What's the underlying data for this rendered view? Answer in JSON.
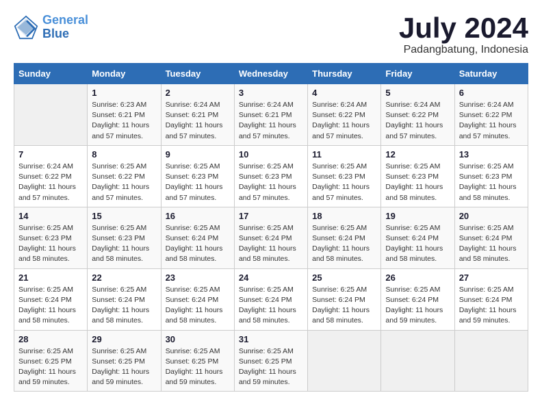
{
  "logo": {
    "line1": "General",
    "line2": "Blue"
  },
  "title": "July 2024",
  "subtitle": "Padangbatung, Indonesia",
  "days_of_week": [
    "Sunday",
    "Monday",
    "Tuesday",
    "Wednesday",
    "Thursday",
    "Friday",
    "Saturday"
  ],
  "weeks": [
    [
      {
        "day": "",
        "info": ""
      },
      {
        "day": "1",
        "info": "Sunrise: 6:23 AM\nSunset: 6:21 PM\nDaylight: 11 hours\nand 57 minutes."
      },
      {
        "day": "2",
        "info": "Sunrise: 6:24 AM\nSunset: 6:21 PM\nDaylight: 11 hours\nand 57 minutes."
      },
      {
        "day": "3",
        "info": "Sunrise: 6:24 AM\nSunset: 6:21 PM\nDaylight: 11 hours\nand 57 minutes."
      },
      {
        "day": "4",
        "info": "Sunrise: 6:24 AM\nSunset: 6:22 PM\nDaylight: 11 hours\nand 57 minutes."
      },
      {
        "day": "5",
        "info": "Sunrise: 6:24 AM\nSunset: 6:22 PM\nDaylight: 11 hours\nand 57 minutes."
      },
      {
        "day": "6",
        "info": "Sunrise: 6:24 AM\nSunset: 6:22 PM\nDaylight: 11 hours\nand 57 minutes."
      }
    ],
    [
      {
        "day": "7",
        "info": "Sunrise: 6:24 AM\nSunset: 6:22 PM\nDaylight: 11 hours\nand 57 minutes."
      },
      {
        "day": "8",
        "info": "Sunrise: 6:25 AM\nSunset: 6:22 PM\nDaylight: 11 hours\nand 57 minutes."
      },
      {
        "day": "9",
        "info": "Sunrise: 6:25 AM\nSunset: 6:23 PM\nDaylight: 11 hours\nand 57 minutes."
      },
      {
        "day": "10",
        "info": "Sunrise: 6:25 AM\nSunset: 6:23 PM\nDaylight: 11 hours\nand 57 minutes."
      },
      {
        "day": "11",
        "info": "Sunrise: 6:25 AM\nSunset: 6:23 PM\nDaylight: 11 hours\nand 57 minutes."
      },
      {
        "day": "12",
        "info": "Sunrise: 6:25 AM\nSunset: 6:23 PM\nDaylight: 11 hours\nand 58 minutes."
      },
      {
        "day": "13",
        "info": "Sunrise: 6:25 AM\nSunset: 6:23 PM\nDaylight: 11 hours\nand 58 minutes."
      }
    ],
    [
      {
        "day": "14",
        "info": "Sunrise: 6:25 AM\nSunset: 6:23 PM\nDaylight: 11 hours\nand 58 minutes."
      },
      {
        "day": "15",
        "info": "Sunrise: 6:25 AM\nSunset: 6:23 PM\nDaylight: 11 hours\nand 58 minutes."
      },
      {
        "day": "16",
        "info": "Sunrise: 6:25 AM\nSunset: 6:24 PM\nDaylight: 11 hours\nand 58 minutes."
      },
      {
        "day": "17",
        "info": "Sunrise: 6:25 AM\nSunset: 6:24 PM\nDaylight: 11 hours\nand 58 minutes."
      },
      {
        "day": "18",
        "info": "Sunrise: 6:25 AM\nSunset: 6:24 PM\nDaylight: 11 hours\nand 58 minutes."
      },
      {
        "day": "19",
        "info": "Sunrise: 6:25 AM\nSunset: 6:24 PM\nDaylight: 11 hours\nand 58 minutes."
      },
      {
        "day": "20",
        "info": "Sunrise: 6:25 AM\nSunset: 6:24 PM\nDaylight: 11 hours\nand 58 minutes."
      }
    ],
    [
      {
        "day": "21",
        "info": "Sunrise: 6:25 AM\nSunset: 6:24 PM\nDaylight: 11 hours\nand 58 minutes."
      },
      {
        "day": "22",
        "info": "Sunrise: 6:25 AM\nSunset: 6:24 PM\nDaylight: 11 hours\nand 58 minutes."
      },
      {
        "day": "23",
        "info": "Sunrise: 6:25 AM\nSunset: 6:24 PM\nDaylight: 11 hours\nand 58 minutes."
      },
      {
        "day": "24",
        "info": "Sunrise: 6:25 AM\nSunset: 6:24 PM\nDaylight: 11 hours\nand 58 minutes."
      },
      {
        "day": "25",
        "info": "Sunrise: 6:25 AM\nSunset: 6:24 PM\nDaylight: 11 hours\nand 58 minutes."
      },
      {
        "day": "26",
        "info": "Sunrise: 6:25 AM\nSunset: 6:24 PM\nDaylight: 11 hours\nand 59 minutes."
      },
      {
        "day": "27",
        "info": "Sunrise: 6:25 AM\nSunset: 6:24 PM\nDaylight: 11 hours\nand 59 minutes."
      }
    ],
    [
      {
        "day": "28",
        "info": "Sunrise: 6:25 AM\nSunset: 6:25 PM\nDaylight: 11 hours\nand 59 minutes."
      },
      {
        "day": "29",
        "info": "Sunrise: 6:25 AM\nSunset: 6:25 PM\nDaylight: 11 hours\nand 59 minutes."
      },
      {
        "day": "30",
        "info": "Sunrise: 6:25 AM\nSunset: 6:25 PM\nDaylight: 11 hours\nand 59 minutes."
      },
      {
        "day": "31",
        "info": "Sunrise: 6:25 AM\nSunset: 6:25 PM\nDaylight: 11 hours\nand 59 minutes."
      },
      {
        "day": "",
        "info": ""
      },
      {
        "day": "",
        "info": ""
      },
      {
        "day": "",
        "info": ""
      }
    ]
  ]
}
